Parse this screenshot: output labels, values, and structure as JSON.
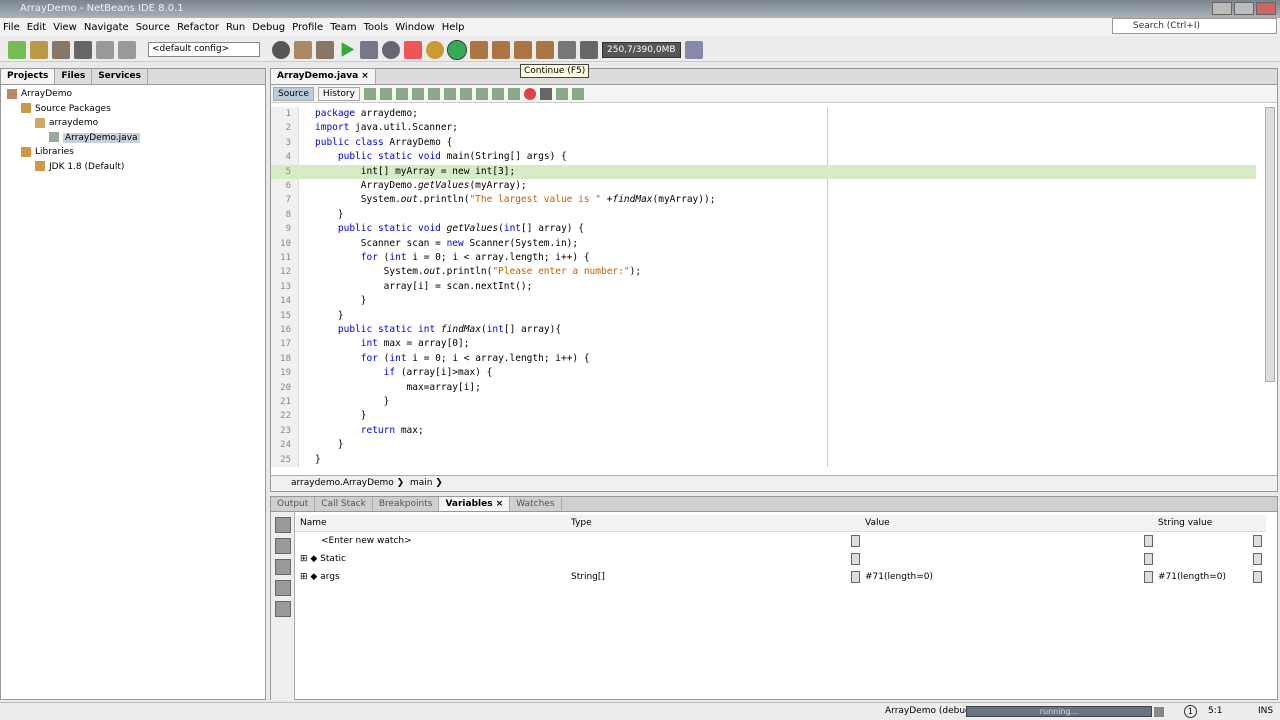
{
  "window": {
    "title": "ArrayDemo - NetBeans IDE 8.0.1"
  },
  "menu": [
    "File",
    "Edit",
    "View",
    "Navigate",
    "Source",
    "Refactor",
    "Run",
    "Debug",
    "Profile",
    "Team",
    "Tools",
    "Window",
    "Help"
  ],
  "search": {
    "placeholder": "Search (Ctrl+I)"
  },
  "toolbar": {
    "config": "<default config>",
    "memory": "250,7/390,0MB",
    "tooltip": "Continue (F5)"
  },
  "projects": {
    "tabs": [
      "Projects",
      "Files",
      "Services"
    ],
    "tree": [
      {
        "label": "ArrayDemo",
        "depth": 0,
        "color": "#b86"
      },
      {
        "label": "Source Packages",
        "depth": 1,
        "color": "#c94"
      },
      {
        "label": "arraydemo",
        "depth": 2,
        "color": "#ca6"
      },
      {
        "label": "ArrayDemo.java",
        "depth": 3,
        "color": "#9a9",
        "selected": true
      },
      {
        "label": "Libraries",
        "depth": 1,
        "color": "#c94"
      },
      {
        "label": "JDK 1.8 (Default)",
        "depth": 2,
        "color": "#c94"
      }
    ]
  },
  "editor": {
    "tab": "ArrayDemo.java",
    "source_label": "Source",
    "history_label": "History",
    "current_line": 5,
    "lines": [
      "package arraydemo;",
      "import java.util.Scanner;",
      "public class ArrayDemo {",
      "    public static void main(String[] args) {",
      "        int[] myArray = new int[3];",
      "        ArrayDemo.getValues(myArray);",
      "        System.out.println(\"The largest value is \" +findMax(myArray));",
      "    }",
      "    public static void getValues(int[] array) {",
      "        Scanner scan = new Scanner(System.in);",
      "        for (int i = 0; i < array.length; i++) {",
      "            System.out.println(\"Please enter a number:\");",
      "            array[i] = scan.nextInt();",
      "        }",
      "    }",
      "    public static int findMax(int[] array){",
      "        int max = array[0];",
      "        for (int i = 0; i < array.length; i++) {",
      "            if (array[i]>max) {",
      "                max=array[i];",
      "            }",
      "        }",
      "        return max;",
      "    }",
      "}"
    ],
    "breadcrumb": [
      "arraydemo.ArrayDemo",
      "main"
    ]
  },
  "bottom": {
    "tabs": [
      "Output",
      "Call Stack",
      "Breakpoints",
      "Variables",
      "Watches"
    ],
    "active": "Variables",
    "columns": [
      "Name",
      "Type",
      "Value",
      "String value"
    ],
    "rows": [
      {
        "name": "<Enter new watch>",
        "type": "",
        "value": "",
        "string": ""
      },
      {
        "name": "Static",
        "type": "",
        "value": "",
        "string": ""
      },
      {
        "name": "args",
        "type": "String[]",
        "value": "#71(length=0)",
        "string": "#71(length=0)"
      }
    ]
  },
  "status": {
    "task": "ArrayDemo (debug)",
    "progress_text": "running...",
    "position": "5:1",
    "mode": "INS",
    "notifications": "1"
  }
}
